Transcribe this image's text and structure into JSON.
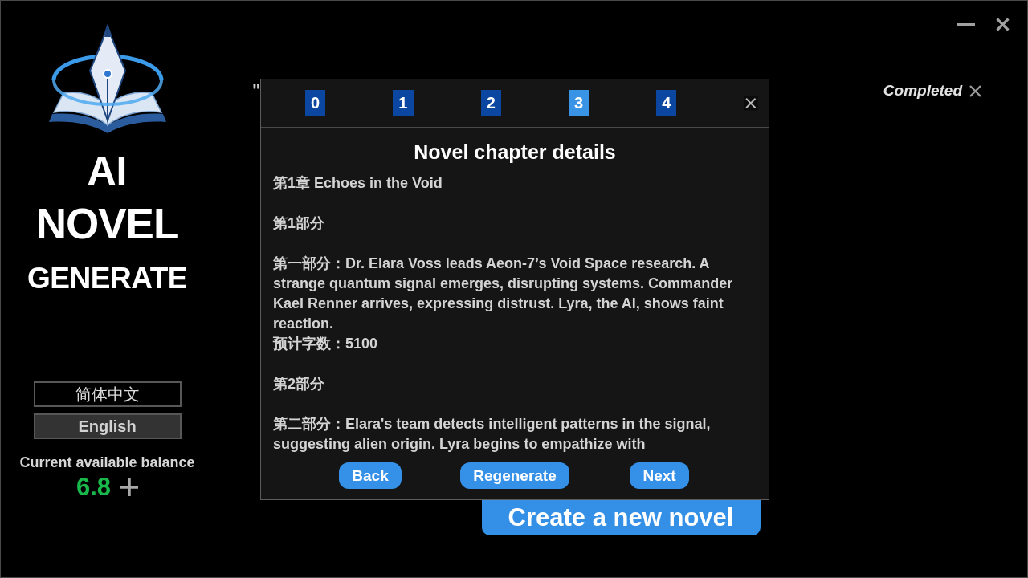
{
  "sidebar": {
    "brand_lines": [
      "AI",
      "NOVEL",
      "GENERATE"
    ],
    "languages": [
      {
        "label": "简体中文",
        "selected": false
      },
      {
        "label": "English",
        "selected": true
      }
    ],
    "balance": {
      "label": "Current available balance",
      "amount": "6.8"
    }
  },
  "main": {
    "covered_text": "\"",
    "status": {
      "label": "Completed"
    },
    "create_button": "Create a new novel"
  },
  "dialog": {
    "tabs": [
      {
        "label": "0",
        "selected": false
      },
      {
        "label": "1",
        "selected": false
      },
      {
        "label": "2",
        "selected": false
      },
      {
        "label": "3",
        "selected": true
      },
      {
        "label": "4",
        "selected": false
      }
    ],
    "title": "Novel chapter details",
    "chapter_heading": "第1章 Echoes in the Void",
    "parts": [
      {
        "heading": "第1部分",
        "summary": "第一部分：Dr. Elara Voss leads Aeon-7’s Void Space research. A strange quantum signal emerges, disrupting systems. Commander Kael Renner arrives, expressing distrust. Lyra, the AI, shows faint reaction.",
        "word_count": "预计字数：5100"
      },
      {
        "heading": "第2部分",
        "summary": "第二部分：Elara's team detects intelligent patterns in the signal, suggesting alien origin. Lyra begins to empathize with"
      }
    ],
    "buttons": [
      "Back",
      "Regenerate",
      "Next"
    ]
  }
}
